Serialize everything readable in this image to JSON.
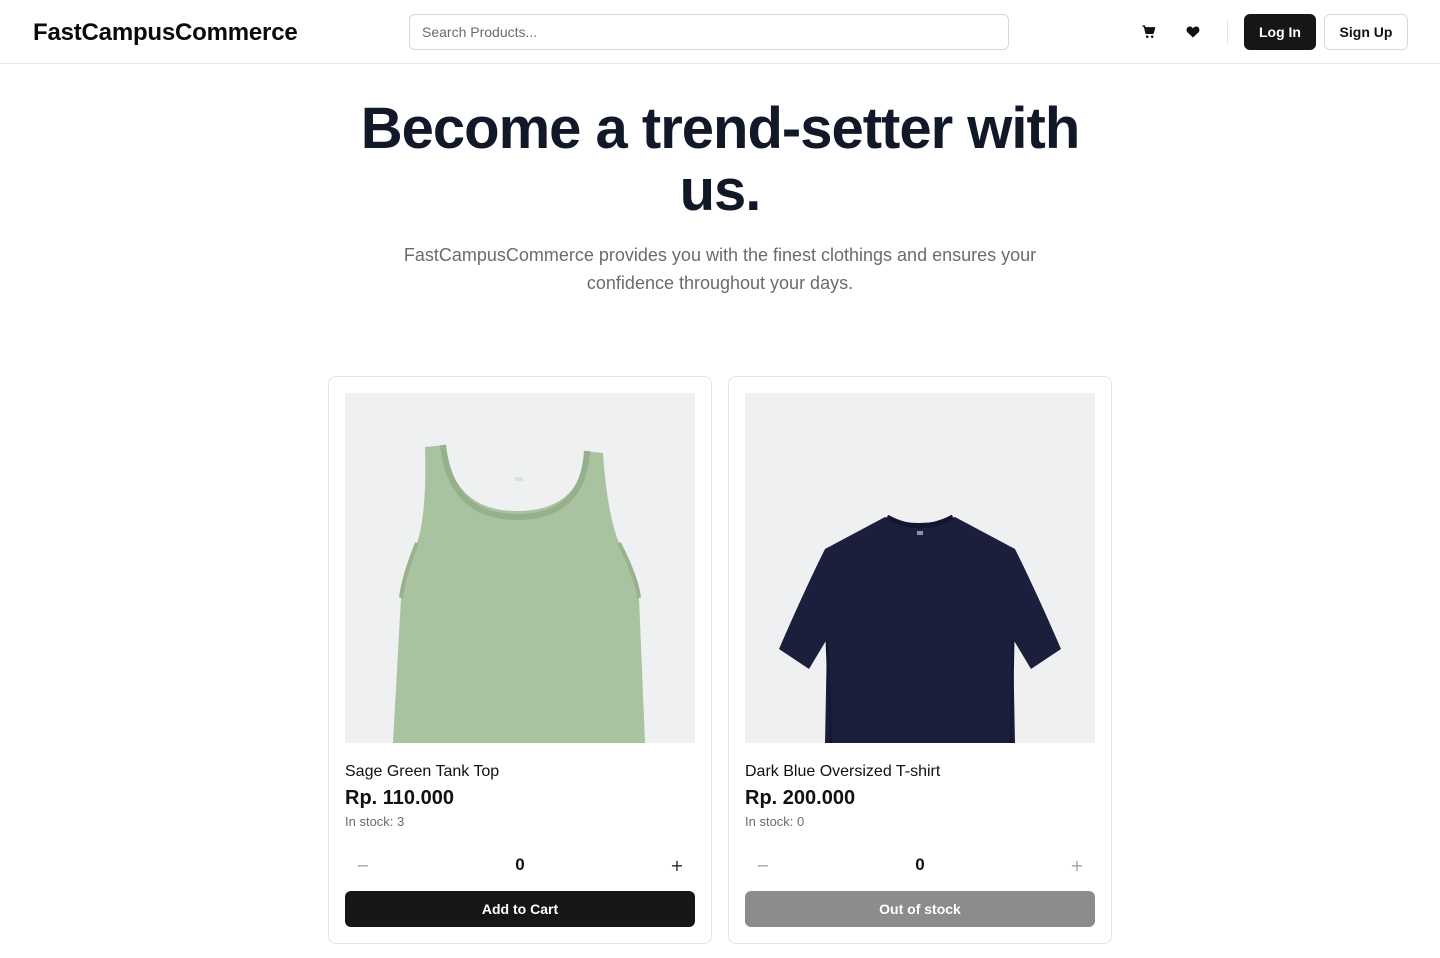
{
  "header": {
    "brand": "FastCampusCommerce",
    "search_placeholder": "Search Products...",
    "cart_icon": "cart-icon",
    "wishlist_icon": "heart-icon",
    "login_label": "Log In",
    "signup_label": "Sign Up"
  },
  "hero": {
    "title": "Become a trend-setter with us.",
    "subtitle": "FastCampusCommerce provides you with the finest clothings and ensures your confidence throughout your days."
  },
  "products": [
    {
      "name": "Sage Green Tank Top",
      "price": "Rp. 110.000",
      "stock": "In stock: 3",
      "quantity": "0",
      "minus": "−",
      "plus": "+",
      "button_label": "Add to Cart",
      "available": true,
      "garment_color": "#a9c29f"
    },
    {
      "name": "Dark Blue Oversized T-shirt",
      "price": "Rp. 200.000",
      "stock": "In stock: 0",
      "quantity": "0",
      "minus": "−",
      "plus": "+",
      "button_label": "Out of stock",
      "available": false,
      "garment_color": "#1b1f3b"
    }
  ],
  "colors": {
    "primary_button": "#161616",
    "disabled_button": "#8c8c8c",
    "muted_text": "#6b6b6b",
    "image_background": "#eef0f2"
  }
}
